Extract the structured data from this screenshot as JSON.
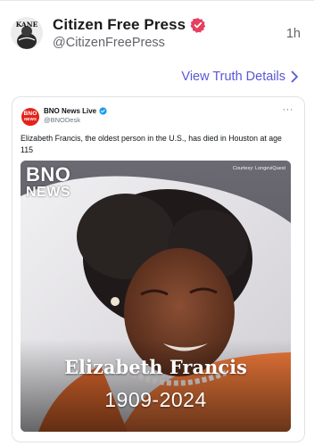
{
  "post": {
    "author_name": "Citizen Free Press",
    "author_handle": "@CitizenFreePress",
    "time_ago": "1h",
    "avatar_text": "KANE",
    "verified_icon": "verified-badge-icon",
    "verified_color": "#e4405f",
    "details_link": "View Truth Details",
    "link_color": "#5a57d6"
  },
  "embed": {
    "author_name": "BNO News Live",
    "author_handle": "@BNODesk",
    "avatar_line1": "BNO",
    "avatar_line2": "NEWS",
    "more_label": "···",
    "text": "Elizabeth Francis, the oldest person in the U.S., has died in Houston at age 115",
    "image": {
      "logo_line1": "BNO",
      "logo_line2": "NEWS",
      "credit": "Courtesy: LongeviQuest",
      "caption_name": "Elizabeth Francis",
      "caption_years": "1909-2024"
    }
  }
}
